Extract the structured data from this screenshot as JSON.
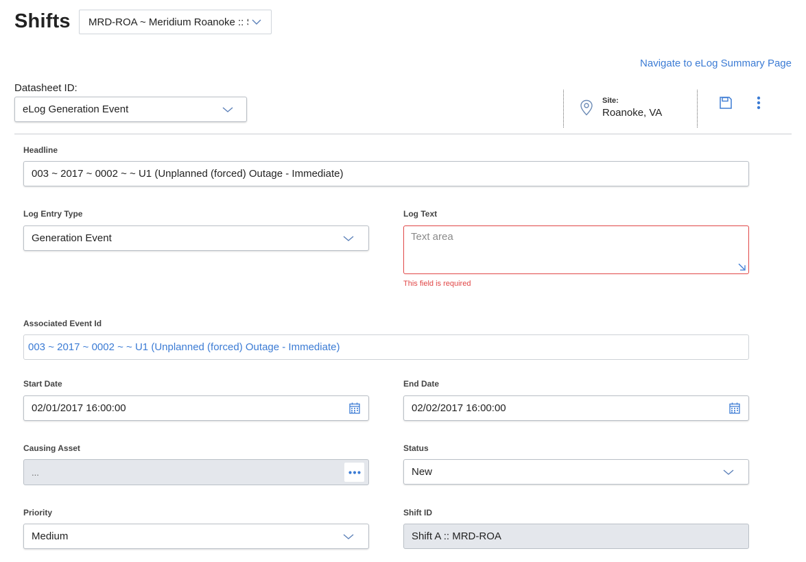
{
  "header": {
    "title": "Shifts",
    "site_selector": "MRD-ROA ~ Meridium Roanoke :: Shift A",
    "nav_link": "Navigate to eLog Summary Page"
  },
  "datasheet": {
    "label": "Datasheet ID:",
    "value": "eLog Generation Event"
  },
  "site": {
    "label": "Site:",
    "value": "Roanoke, VA"
  },
  "colors": {
    "accent": "#3b7bd4",
    "error": "#e04545",
    "readonly_bg": "#e4e7ec"
  },
  "form": {
    "headline": {
      "label": "Headline",
      "value": "003 ~ 2017 ~ 0002 ~  ~ U1 (Unplanned (forced) Outage - Immediate)"
    },
    "log_entry_type": {
      "label": "Log Entry Type",
      "value": "Generation Event"
    },
    "log_text": {
      "label": "Log Text",
      "placeholder": "Text area",
      "error": "This field is required"
    },
    "associated_event": {
      "label": "Associated Event Id",
      "value": "003 ~ 2017 ~ 0002 ~ ~ U1 (Unplanned (forced) Outage - Immediate)"
    },
    "start_date": {
      "label": "Start Date",
      "value": "02/01/2017 16:00:00"
    },
    "end_date": {
      "label": "End Date",
      "value": "02/02/2017 16:00:00"
    },
    "causing_asset": {
      "label": "Causing Asset",
      "value": "..."
    },
    "status": {
      "label": "Status",
      "value": "New"
    },
    "priority": {
      "label": "Priority",
      "value": "Medium"
    },
    "shift_id": {
      "label": "Shift ID",
      "value": "Shift A :: MRD-ROA"
    }
  },
  "icons": [
    "chevron-down-icon",
    "location-pin-icon",
    "save-icon",
    "more-vertical-icon",
    "calendar-icon",
    "ellipsis-icon",
    "resize-icon"
  ]
}
